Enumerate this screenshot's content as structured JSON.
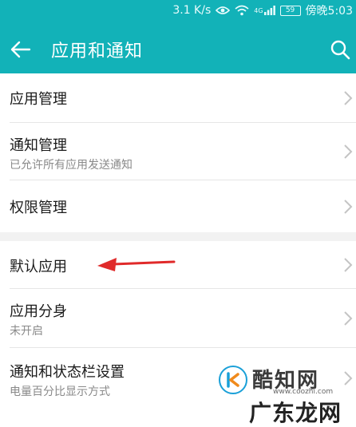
{
  "status_bar": {
    "speed": "3.1 K/s",
    "network": "4G",
    "battery": "59",
    "time": "傍晚5:03"
  },
  "app_bar": {
    "title": "应用和通知",
    "back_icon": "arrow-left-icon",
    "search_icon": "search-icon"
  },
  "groups": [
    {
      "items": [
        {
          "label": "应用管理",
          "sub": ""
        },
        {
          "label": "通知管理",
          "sub": "已允许所有应用发送通知"
        },
        {
          "label": "权限管理",
          "sub": ""
        }
      ]
    },
    {
      "items": [
        {
          "label": "默认应用",
          "sub": ""
        },
        {
          "label": "应用分身",
          "sub": "未开启"
        },
        {
          "label": "通知和状态栏设置",
          "sub": "电量百分比显示方式"
        }
      ]
    }
  ],
  "watermark": {
    "line1": "酷知网",
    "url": "www.coozhi.com",
    "line2": "广东龙网"
  },
  "colors": {
    "primary": "#12b2b8",
    "annotation": "#e02a2a"
  }
}
